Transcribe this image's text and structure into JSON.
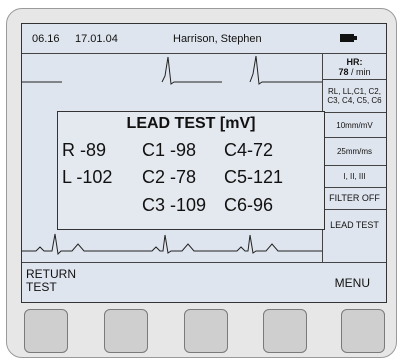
{
  "header": {
    "time": "06.16",
    "date": "17.01.04",
    "patient_name": "Harrison, Stephen",
    "battery_icon": "battery-icon"
  },
  "side_panel": {
    "hr_label": "HR:",
    "hr_value": "78",
    "hr_unit": "/ min",
    "leads": "RL, LL,C1, C2, C3, C4, C5, C6",
    "sensitivity": "10mm/mV",
    "speed": "25mm/ms",
    "lead_set": "I, II, III",
    "filter": "FILTER OFF",
    "lead_test": "LEAD TEST"
  },
  "footer": {
    "left_line1": "RETURN",
    "left_line2": "TEST",
    "right": "MENU"
  },
  "dialog": {
    "title": "LEAD TEST [mV]",
    "r": "R -89",
    "l": "L -102",
    "c1": "C1 -98",
    "c2": "C2 -78",
    "c3": "C3 -109",
    "c4": "C4-72",
    "c5": "C5-121",
    "c6": "C6-96"
  },
  "colors": {
    "screen_bg": "#dfe5ee",
    "device_bg": "#e7e7e7",
    "button_bg": "#cfcfcf"
  }
}
